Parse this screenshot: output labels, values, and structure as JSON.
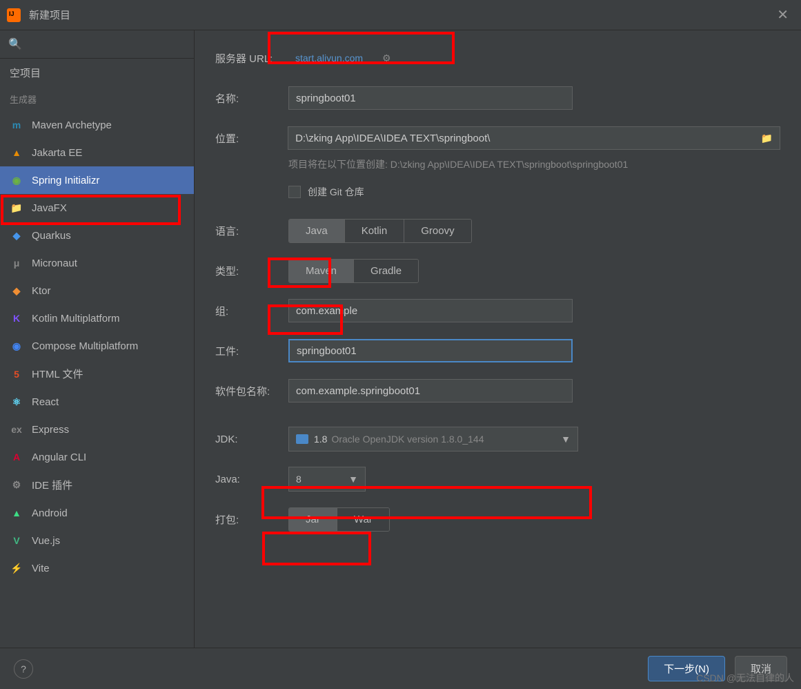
{
  "window": {
    "title": "新建项目"
  },
  "sidebar": {
    "empty_project": "空项目",
    "generators_header": "生成器",
    "items": [
      {
        "label": "Maven Archetype",
        "icon_color": "#2c8ab3",
        "icon_letter": "m"
      },
      {
        "label": "Jakarta EE",
        "icon_color": "#e78c05",
        "icon_letter": "▲"
      },
      {
        "label": "Spring Initializr",
        "icon_color": "#6db33f",
        "icon_letter": "◉"
      },
      {
        "label": "JavaFX",
        "icon_color": "#5b7fa6",
        "icon_letter": "📁"
      },
      {
        "label": "Quarkus",
        "icon_color": "#4695eb",
        "icon_letter": "◆"
      },
      {
        "label": "Micronaut",
        "icon_color": "#888",
        "icon_letter": "μ"
      },
      {
        "label": "Ktor",
        "icon_color": "#f18e33",
        "icon_letter": "◆"
      },
      {
        "label": "Kotlin Multiplatform",
        "icon_color": "#7f52ff",
        "icon_letter": "K"
      },
      {
        "label": "Compose Multiplatform",
        "icon_color": "#4285f4",
        "icon_letter": "◉"
      },
      {
        "label": "HTML 文件",
        "icon_color": "#e44d26",
        "icon_letter": "5"
      },
      {
        "label": "React",
        "icon_color": "#61dafb",
        "icon_letter": "⚛"
      },
      {
        "label": "Express",
        "icon_color": "#888",
        "icon_letter": "ex"
      },
      {
        "label": "Angular CLI",
        "icon_color": "#dd0031",
        "icon_letter": "A"
      },
      {
        "label": "IDE 插件",
        "icon_color": "#888",
        "icon_letter": "⚙"
      },
      {
        "label": "Android",
        "icon_color": "#3ddc84",
        "icon_letter": "▲"
      },
      {
        "label": "Vue.js",
        "icon_color": "#41b883",
        "icon_letter": "V"
      },
      {
        "label": "Vite",
        "icon_color": "#bd34fe",
        "icon_letter": "⚡"
      }
    ]
  },
  "form": {
    "server_url_label": "服务器 URL:",
    "server_url_value": "start.aliyun.com",
    "name_label": "名称:",
    "name_value": "springboot01",
    "location_label": "位置:",
    "location_value": "D:\\zking App\\IDEA\\IDEA TEXT\\springboot\\",
    "location_hint": "项目将在以下位置创建: D:\\zking App\\IDEA\\IDEA TEXT\\springboot\\springboot01",
    "git_checkbox": "创建 Git 仓库",
    "language_label": "语言:",
    "language_options": [
      "Java",
      "Kotlin",
      "Groovy"
    ],
    "type_label": "类型:",
    "type_options": [
      "Maven",
      "Gradle"
    ],
    "group_label": "组:",
    "group_value": "com.example",
    "artifact_label": "工件:",
    "artifact_value": "springboot01",
    "package_label": "软件包名称:",
    "package_value": "com.example.springboot01",
    "jdk_label": "JDK:",
    "jdk_version": "1.8",
    "jdk_detail": "Oracle OpenJDK version 1.8.0_144",
    "java_label": "Java:",
    "java_value": "8",
    "packaging_label": "打包:",
    "packaging_options": [
      "Jar",
      "War"
    ]
  },
  "footer": {
    "help": "?",
    "next": "下一步(N)",
    "cancel": "取消"
  },
  "watermark": "CSDN @无法自律的人"
}
